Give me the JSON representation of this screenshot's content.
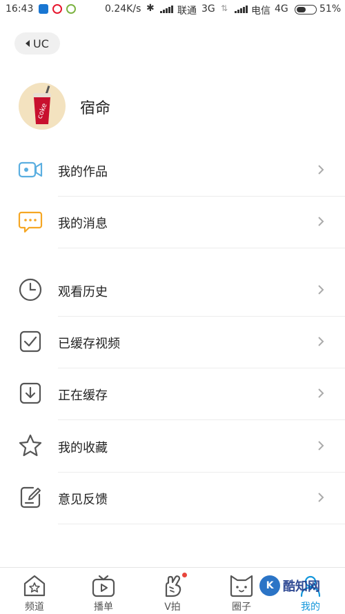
{
  "status_bar": {
    "time": "16:43",
    "speed": "0.24K/s",
    "bluetooth": "✱",
    "carrier1": "联通",
    "net1": "3G",
    "arrows": "⇅",
    "carrier2": "电信",
    "net2": "4G",
    "battery_percent": "51%",
    "battery_level": 0.51
  },
  "back": {
    "label": "UC"
  },
  "profile": {
    "name": "宿命"
  },
  "avatar_cup_text": "coke",
  "menu": {
    "items": [
      {
        "label": "我的作品",
        "icon": "video-camera-icon"
      },
      {
        "label": "我的消息",
        "icon": "chat-bubble-icon"
      },
      {
        "label": "观看历史",
        "icon": "clock-icon"
      },
      {
        "label": "已缓存视频",
        "icon": "checked-box-icon"
      },
      {
        "label": "正在缓存",
        "icon": "download-box-icon"
      },
      {
        "label": "我的收藏",
        "icon": "star-icon"
      },
      {
        "label": "意见反馈",
        "icon": "feedback-edit-icon"
      }
    ]
  },
  "tabs": [
    {
      "label": "频道",
      "icon": "home-star-icon"
    },
    {
      "label": "播单",
      "icon": "tv-play-icon"
    },
    {
      "label": "V拍",
      "icon": "hand-icon"
    },
    {
      "label": "圈子",
      "icon": "cat-face-icon"
    },
    {
      "label": "我的",
      "icon": "profile-icon",
      "active": true
    }
  ],
  "watermark": {
    "text": "酷知网",
    "badge": "K"
  },
  "colors": {
    "accent_blue": "#1296db",
    "message_orange": "#f5a623",
    "red_dot": "#e8453c"
  }
}
